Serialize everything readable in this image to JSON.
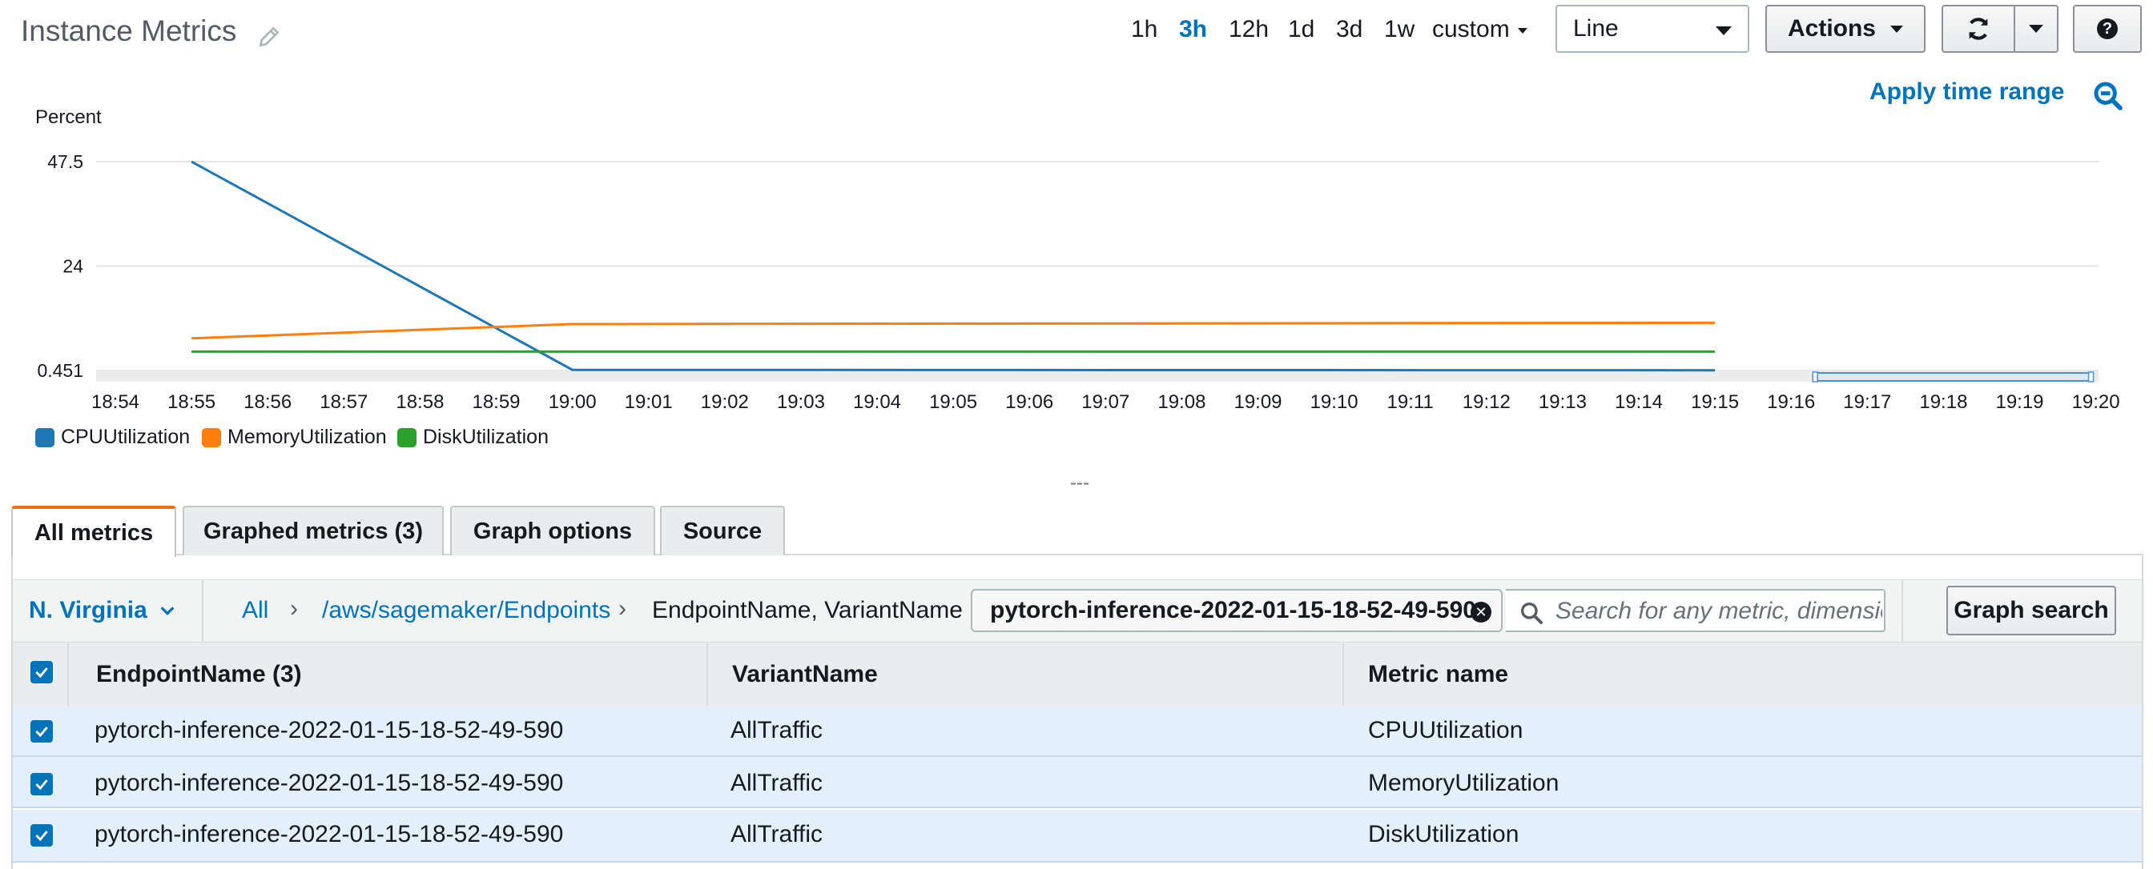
{
  "header": {
    "title": "Instance Metrics",
    "time_ranges": [
      "1h",
      "3h",
      "12h",
      "1d",
      "3d",
      "1w"
    ],
    "active_range": "3h",
    "custom_label": "custom",
    "view_type": "Line",
    "actions_label": "Actions",
    "help_label": "?",
    "apply_time_range": "Apply time range"
  },
  "chart_data": {
    "type": "line",
    "ylabel": "Percent",
    "y_ticks": [
      "47.5",
      "24",
      "0.451"
    ],
    "ylim": [
      0.451,
      47.5
    ],
    "x_ticks": [
      "18:54",
      "18:55",
      "18:56",
      "18:57",
      "18:58",
      "18:59",
      "19:00",
      "19:01",
      "19:02",
      "19:03",
      "19:04",
      "19:05",
      "19:06",
      "19:07",
      "19:08",
      "19:09",
      "19:10",
      "19:11",
      "19:12",
      "19:13",
      "19:14",
      "19:15",
      "19:16",
      "19:17",
      "19:18",
      "19:19",
      "19:20"
    ],
    "series": [
      {
        "name": "CPUUtilization",
        "color": "#1f77b4",
        "points": [
          [
            "18:55",
            47.5
          ],
          [
            "19:00",
            0.6
          ],
          [
            "19:15",
            0.5
          ]
        ]
      },
      {
        "name": "MemoryUtilization",
        "color": "#ff7f0e",
        "points": [
          [
            "18:55",
            7.7
          ],
          [
            "19:00",
            10.9
          ],
          [
            "19:15",
            11.2
          ]
        ]
      },
      {
        "name": "DiskUtilization",
        "color": "#2ca02c",
        "points": [
          [
            "18:55",
            4.7
          ],
          [
            "19:00",
            4.7
          ],
          [
            "19:15",
            4.7
          ]
        ]
      }
    ],
    "grid": true,
    "legend": "bottom-left"
  },
  "splitter_label": "---",
  "tabs": [
    "All metrics",
    "Graphed metrics (3)",
    "Graph options",
    "Source"
  ],
  "filter": {
    "region": "N. Virginia",
    "breadcrumb": [
      "All",
      "/aws/sagemaker/Endpoints",
      "EndpointName, VariantName"
    ],
    "token": "pytorch-inference-2022-01-15-18-52-49-590",
    "search_placeholder": "Search for any metric, dimension or resource id",
    "graph_search_label": "Graph search"
  },
  "table": {
    "columns": [
      "EndpointName  (3)",
      "VariantName",
      "Metric name"
    ],
    "rows": [
      {
        "endpoint": "pytorch-inference-2022-01-15-18-52-49-590",
        "variant": "AllTraffic",
        "metric": "CPUUtilization"
      },
      {
        "endpoint": "pytorch-inference-2022-01-15-18-52-49-590",
        "variant": "AllTraffic",
        "metric": "MemoryUtilization"
      },
      {
        "endpoint": "pytorch-inference-2022-01-15-18-52-49-590",
        "variant": "AllTraffic",
        "metric": "DiskUtilization"
      }
    ]
  }
}
